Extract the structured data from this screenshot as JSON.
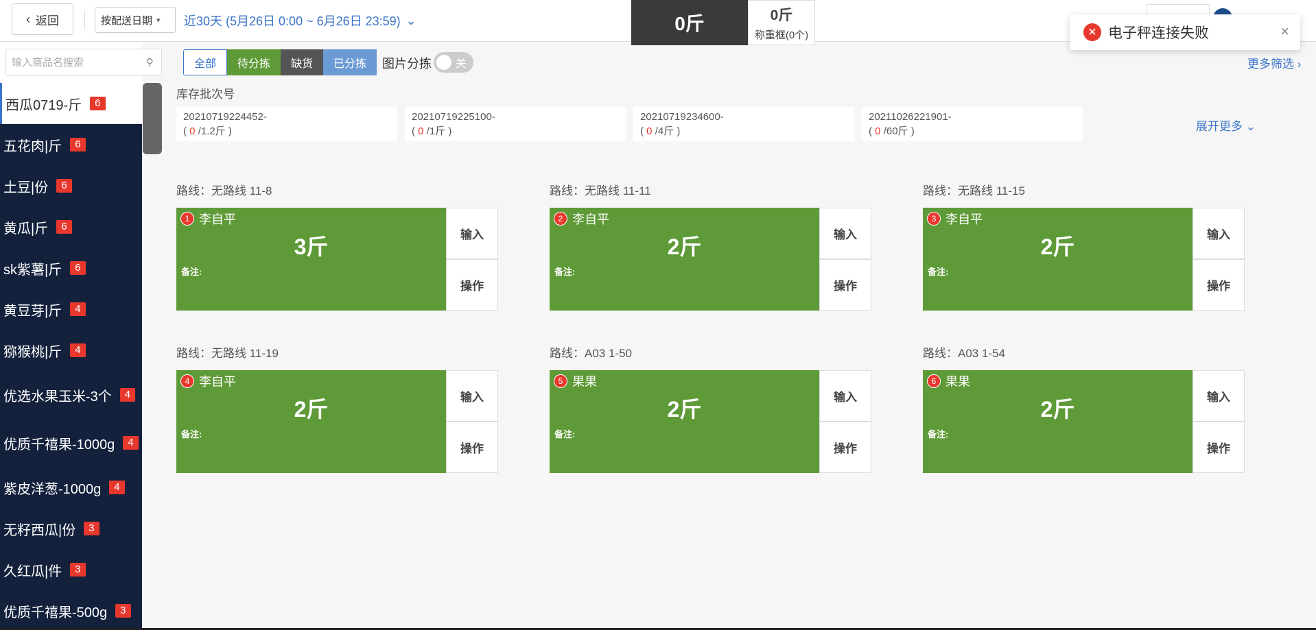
{
  "header": {
    "back_label": "返回",
    "date_type": "按配送日期",
    "date_range": "近30天 (5月26日 0:00 ~ 6月26日 23:59)",
    "weight_display": "0斤",
    "basket_weight": "0斤",
    "basket_label": "称重框(0个)"
  },
  "toast": {
    "message": "电子秤连接失败"
  },
  "search": {
    "placeholder": "输入商品名搜索"
  },
  "products": [
    {
      "name": "西瓜0719-斤",
      "count": "6"
    },
    {
      "name": "五花肉|斤",
      "count": "6"
    },
    {
      "name": "土豆|份",
      "count": "6"
    },
    {
      "name": "黄瓜|斤",
      "count": "6"
    },
    {
      "name": "sk紫薯|斤",
      "count": "6"
    },
    {
      "name": "黄豆芽|斤",
      "count": "4"
    },
    {
      "name": "猕猴桃|斤",
      "count": "4"
    },
    {
      "name": "优选水果玉米-3个",
      "count": "4"
    },
    {
      "name": "优质千禧果-1000g",
      "count": "4"
    },
    {
      "name": "紫皮洋葱-1000g",
      "count": "4"
    },
    {
      "name": "无籽西瓜|份",
      "count": "3"
    },
    {
      "name": "久红瓜|件",
      "count": "3"
    },
    {
      "name": "优质千禧果-500g",
      "count": "3"
    }
  ],
  "filters": {
    "all": "全部",
    "pending": "待分拣",
    "shortage": "缺货",
    "sorted": "已分拣",
    "image_sort": "图片分拣",
    "toggle_state": "关",
    "more": "更多筛选"
  },
  "batches": {
    "title": "库存批次号",
    "expand": "展开更多",
    "items": [
      {
        "code": "20210719224452-",
        "used": "0",
        "total": "/1.2斤"
      },
      {
        "code": "20210719225100-",
        "used": "0",
        "total": "/1斤"
      },
      {
        "code": "20210719234600-",
        "used": "0",
        "total": "/4斤"
      },
      {
        "code": "20211026221901-",
        "used": "0",
        "total": "/60斤"
      }
    ]
  },
  "orders": [
    {
      "route": "路线：无路线 11-8",
      "num": "1",
      "customer": "李自平",
      "qty": "3斤",
      "note": "备注:",
      "input": "输入",
      "op": "操作"
    },
    {
      "route": "路线：无路线 11-11",
      "num": "2",
      "customer": "李自平",
      "qty": "2斤",
      "note": "备注:",
      "input": "输入",
      "op": "操作"
    },
    {
      "route": "路线：无路线 11-15",
      "num": "3",
      "customer": "李自平",
      "qty": "2斤",
      "note": "备注:",
      "input": "输入",
      "op": "操作"
    },
    {
      "route": "路线：无路线 11-19",
      "num": "4",
      "customer": "李自平",
      "qty": "2斤",
      "note": "备注:",
      "input": "输入",
      "op": "操作"
    },
    {
      "route": "路线：A03 1-50",
      "num": "5",
      "customer": "果果",
      "qty": "2斤",
      "note": "备注:",
      "input": "输入",
      "op": "操作"
    },
    {
      "route": "路线：A03 1-54",
      "num": "6",
      "customer": "果果",
      "qty": "2斤",
      "note": "备注:",
      "input": "输入",
      "op": "操作"
    }
  ]
}
